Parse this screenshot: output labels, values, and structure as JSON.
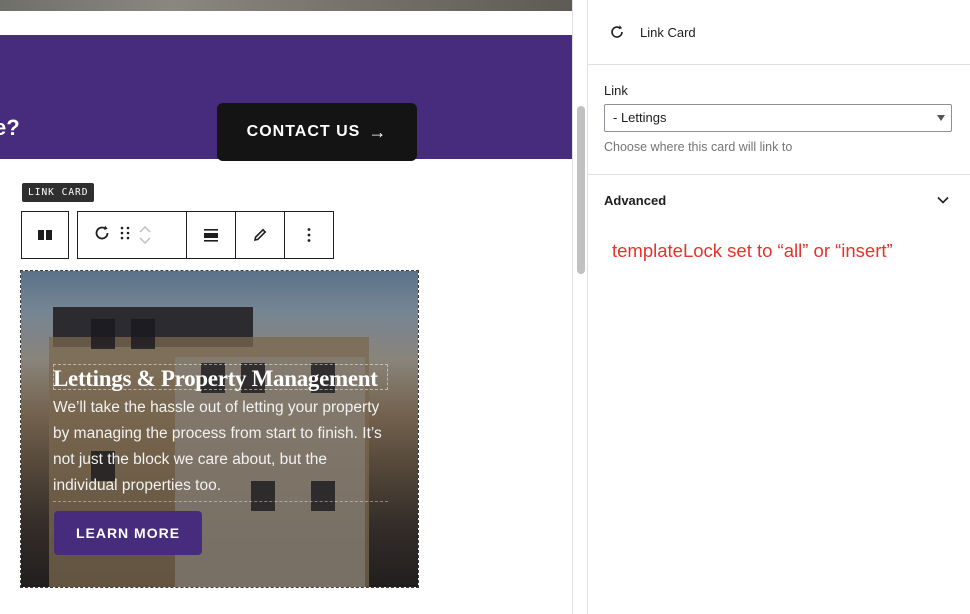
{
  "canvas": {
    "cta": {
      "question_fragment": "e?",
      "button_label": "CONTACT US",
      "button_arrow": "→"
    },
    "block_label": "LINK CARD",
    "card": {
      "title": "Lettings & Property Management",
      "text": "We’ll take the hassle out of letting your property by managing the process from start to finish. It’s not just the block we care about, but the individual properties too.",
      "button_label": "LEARN MORE"
    }
  },
  "sidebar": {
    "header_title": "Link Card",
    "link": {
      "label": "Link",
      "selected": "- Lettings",
      "help": "Choose where this card will link to"
    },
    "advanced_label": "Advanced",
    "annotation": "templateLock set to “all” or “insert”"
  },
  "colors": {
    "brand_purple": "#472c7d",
    "contact_button": "#141414",
    "annotation_red": "#e8322a"
  }
}
